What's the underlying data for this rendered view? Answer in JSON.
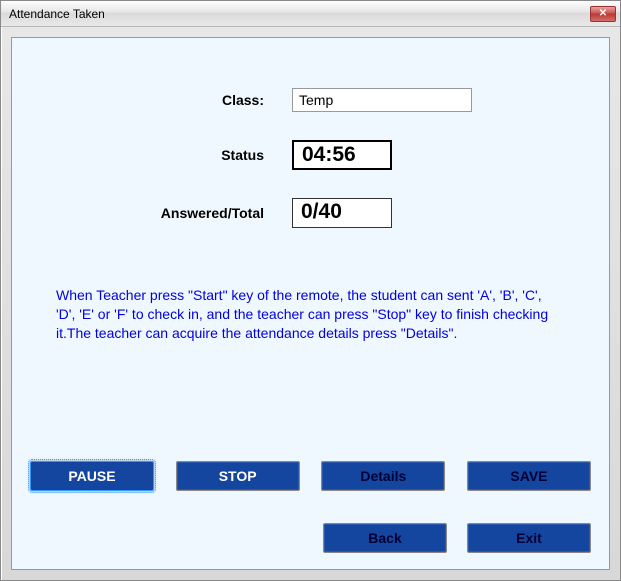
{
  "window": {
    "title": "Attendance Taken"
  },
  "form": {
    "class_label": "Class:",
    "class_value": "Temp",
    "status_label": "Status",
    "status_value": "04:56",
    "answered_label": "Answered/Total",
    "answered_value": "0/40"
  },
  "instruction": "When Teacher press \"Start\" key of the remote, the student can sent 'A', 'B', 'C', 'D', 'E' or 'F' to check in, and the teacher can press \"Stop\" key to finish checking it.The teacher can acquire the attendance details press \"Details\".",
  "buttons": {
    "pause": "PAUSE",
    "stop": "STOP",
    "details": "Details",
    "save": "SAVE",
    "back": "Back",
    "exit": "Exit"
  },
  "icons": {
    "close": "✕"
  }
}
